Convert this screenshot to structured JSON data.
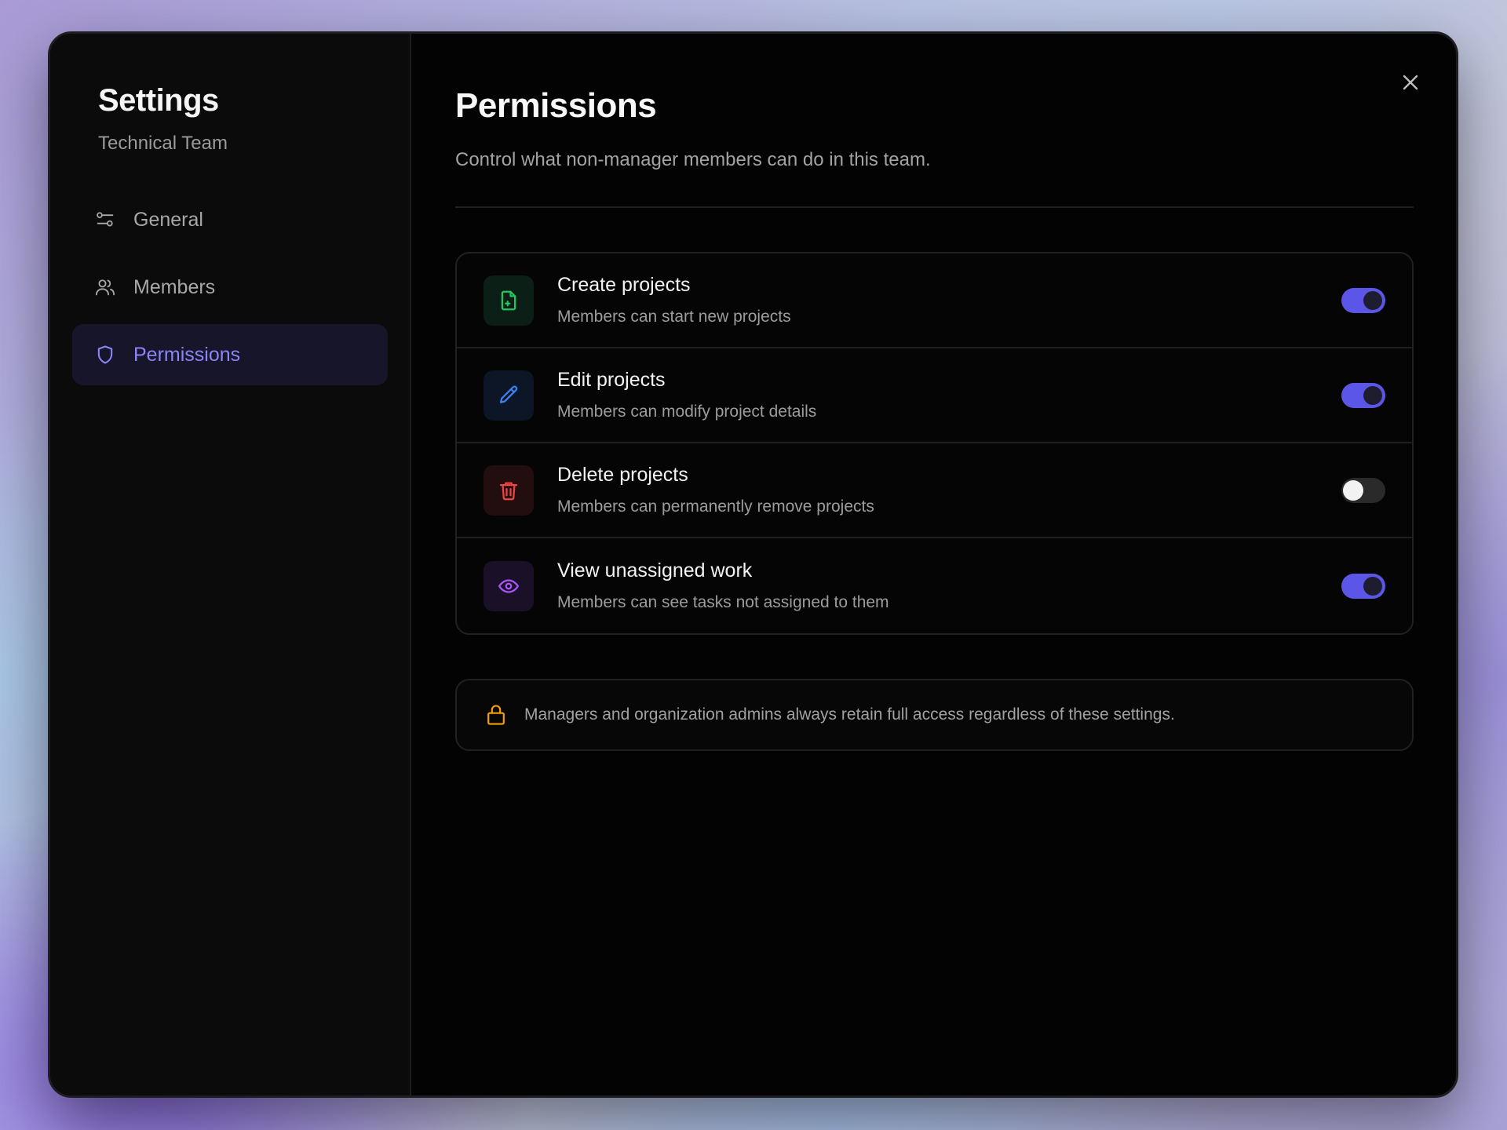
{
  "sidebar": {
    "title": "Settings",
    "subtitle": "Technical Team",
    "items": [
      {
        "label": "General",
        "icon": "sliders-icon",
        "active": false
      },
      {
        "label": "Members",
        "icon": "users-icon",
        "active": false
      },
      {
        "label": "Permissions",
        "icon": "shield-icon",
        "active": true
      }
    ]
  },
  "main": {
    "title": "Permissions",
    "description": "Control what non-manager members can do in this team.",
    "permissions": [
      {
        "title": "Create projects",
        "description": "Members can start new projects",
        "icon": "file-plus-icon",
        "enabled": true,
        "color": "#22c55e"
      },
      {
        "title": "Edit projects",
        "description": "Members can modify project details",
        "icon": "pencil-icon",
        "enabled": true,
        "color": "#3b82f6"
      },
      {
        "title": "Delete projects",
        "description": "Members can permanently remove projects",
        "icon": "trash-icon",
        "enabled": false,
        "color": "#ef4444"
      },
      {
        "title": "View unassigned work",
        "description": "Members can see tasks not assigned to them",
        "icon": "eye-icon",
        "enabled": true,
        "color": "#a855f7"
      }
    ],
    "note": {
      "icon": "lock-icon",
      "text": "Managers and organization admins always retain full access regardless of these settings.",
      "color": "#f59e0b"
    }
  },
  "colors": {
    "accent": "#5b56e8",
    "active_nav_text": "#8b85f5",
    "background": "#030303"
  }
}
